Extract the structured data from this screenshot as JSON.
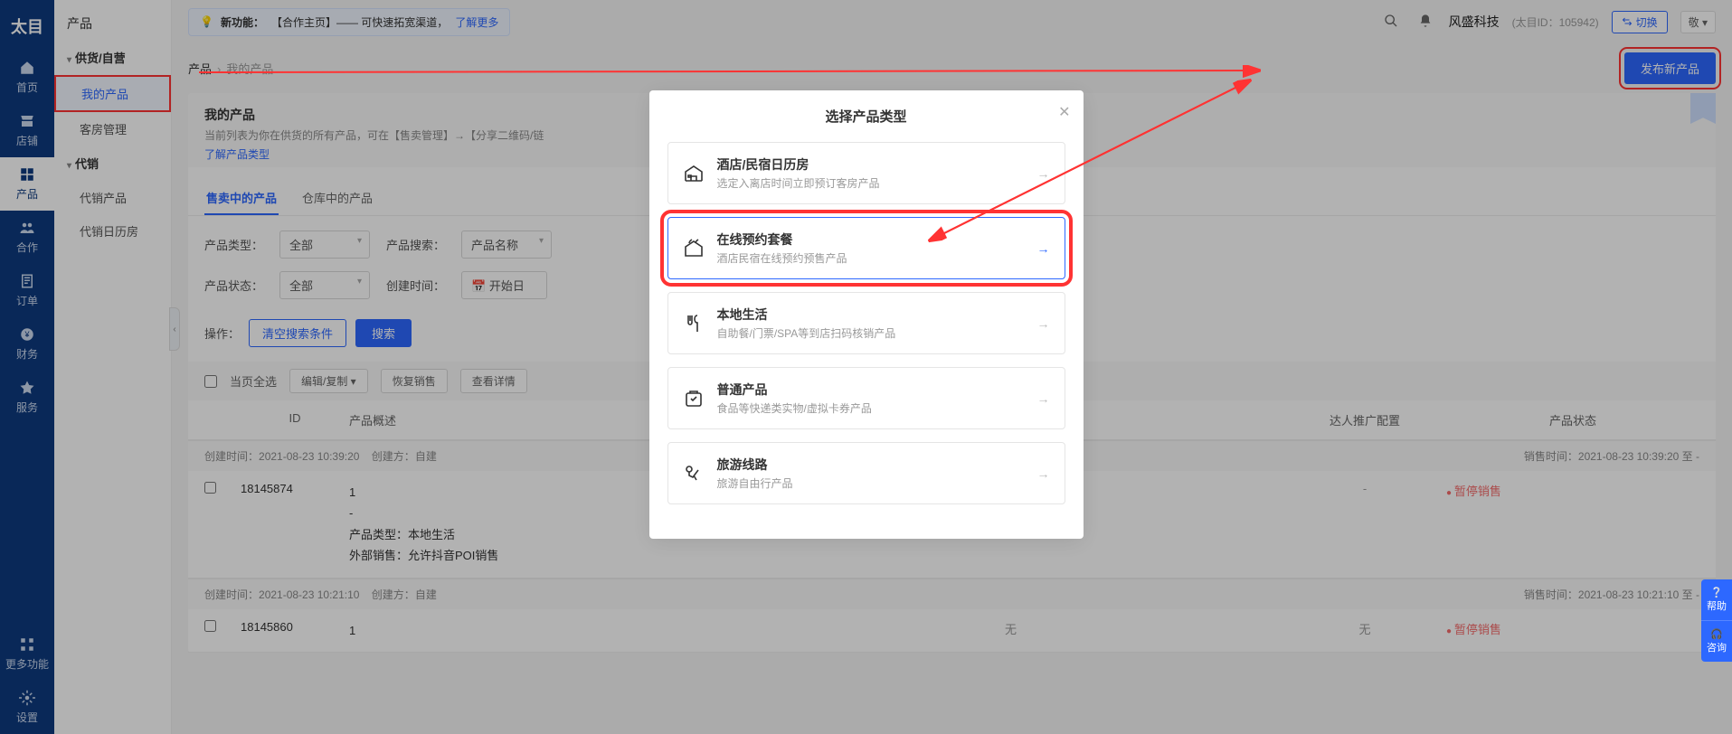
{
  "brand": "太目",
  "leftnav": [
    {
      "id": "home",
      "label": "首页"
    },
    {
      "id": "shop",
      "label": "店铺"
    },
    {
      "id": "product",
      "label": "产品",
      "active": true
    },
    {
      "id": "coop",
      "label": "合作"
    },
    {
      "id": "order",
      "label": "订单"
    },
    {
      "id": "finance",
      "label": "财务"
    },
    {
      "id": "service",
      "label": "服务"
    },
    {
      "id": "more",
      "label": "更多功能"
    },
    {
      "id": "settings",
      "label": "设置"
    }
  ],
  "sidebar": {
    "header": "产品",
    "groups": [
      {
        "label": "供货/自营",
        "items": [
          {
            "label": "我的产品",
            "active": true
          },
          {
            "label": "客房管理"
          }
        ]
      },
      {
        "label": "代销",
        "items": [
          {
            "label": "代销产品"
          },
          {
            "label": "代销日历房"
          }
        ]
      }
    ]
  },
  "notice": {
    "tag": "新功能：",
    "text": "【合作主页】—— 可快速拓宽渠道，",
    "link": "了解更多"
  },
  "header": {
    "company": "风盛科技",
    "meta": "(太目ID：105942)",
    "switch": "切换",
    "more": "敬 ▾"
  },
  "crumb": {
    "root": "产品",
    "current": "我的产品"
  },
  "publish_btn": "发布新产品",
  "panel": {
    "title": "我的产品",
    "desc": "当前列表为你在供货的所有产品，可在【售卖管理】→【分享二维码/链",
    "learn": "了解产品类型"
  },
  "tabs": [
    {
      "label": "售卖中的产品",
      "active": true
    },
    {
      "label": "仓库中的产品"
    }
  ],
  "filters": {
    "type_label": "产品类型：",
    "type_value": "全部",
    "search_label": "产品搜索：",
    "search_value": "产品名称",
    "status_label": "产品状态：",
    "status_value": "全部",
    "time_label": "创建时间：",
    "time_value": "开始日"
  },
  "ops": {
    "label": "操作：",
    "clear": "清空搜索条件",
    "search": "搜索"
  },
  "bulk": {
    "selectall": "当页全选",
    "editcopy": "编辑/复制 ▾",
    "restore": "恢复销售",
    "detail": "查看详情"
  },
  "columns": {
    "id": "ID",
    "desc": "产品概述",
    "promo": "达人推广配置",
    "status": "产品状态"
  },
  "rows": [
    {
      "created_label": "创建时间：",
      "created": "2021-08-23 10:39:20",
      "side_label": "创建方：",
      "side": "自建",
      "sale_label": "销售时间：",
      "sale": "2021-08-23 10:39:20 至 -",
      "id": "18145874",
      "desc_lines": [
        "1",
        "-",
        "产品类型：本地生活",
        "外部销售：允许抖音POI销售"
      ],
      "promo": "-",
      "status": "暂停销售"
    },
    {
      "created_label": "创建时间：",
      "created": "2021-08-23 10:21:10",
      "side_label": "创建方：",
      "side": "自建",
      "sale_label": "销售时间：",
      "sale": "2021-08-23 10:21:10 至 -",
      "id": "18145860",
      "desc_lines": [
        "1"
      ],
      "promo": "无",
      "status": "暂停销售"
    }
  ],
  "modal": {
    "title": "选择产品类型",
    "options": [
      {
        "icon": "hotel",
        "t": "酒店/民宿日历房",
        "d": "选定入离店时间立即预订客房产品"
      },
      {
        "icon": "package",
        "t": "在线预约套餐",
        "d": "酒店民宿在线预约预售产品",
        "selected": true
      },
      {
        "icon": "local",
        "t": "本地生活",
        "d": "自助餐/门票/SPA等到店扫码核销产品"
      },
      {
        "icon": "goods",
        "t": "普通产品",
        "d": "食品等快递类实物/虚拟卡券产品"
      },
      {
        "icon": "travel",
        "t": "旅游线路",
        "d": "旅游自由行产品"
      }
    ]
  },
  "float": {
    "help": "帮助",
    "consult": "咨询"
  }
}
